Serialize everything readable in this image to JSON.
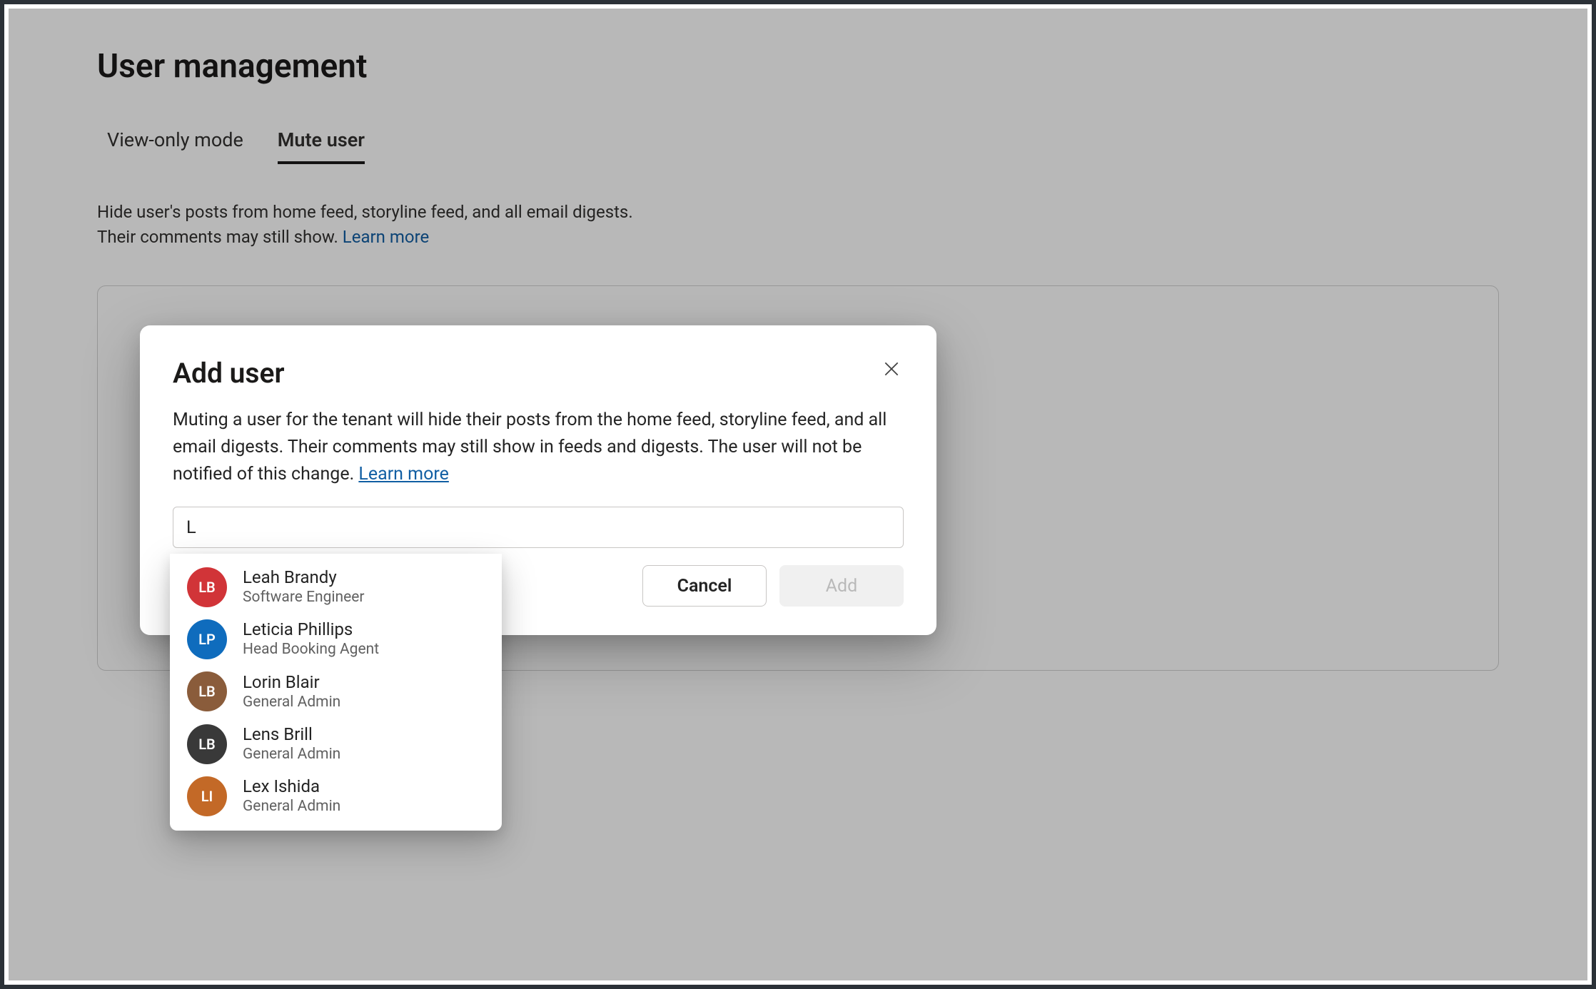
{
  "page": {
    "title": "User management",
    "tabs": [
      {
        "label": "View-only mode",
        "active": false
      },
      {
        "label": "Mute user",
        "active": true
      }
    ],
    "description_line1": "Hide user's posts from home feed, storyline feed, and all email digests.",
    "description_line2": "Their comments may still show. ",
    "learn_more": "Learn more"
  },
  "dialog": {
    "title": "Add user",
    "body": "Muting a user for the tenant will hide their posts from the home feed, storyline feed, and all email digests. Their comments may still show in feeds and digests. The user will not be notified of this change. ",
    "learn_more": "Learn more",
    "search_value": "L",
    "cancel_label": "Cancel",
    "add_label": "Add"
  },
  "suggestions": [
    {
      "name": "Leah Brandy",
      "role": "Software Engineer",
      "avatar_bg": "#d13438",
      "initials": "LB"
    },
    {
      "name": "Leticia Phillips",
      "role": "Head Booking Agent",
      "avatar_bg": "#0f6cbd",
      "initials": "LP"
    },
    {
      "name": "Lorin Blair",
      "role": "General Admin",
      "avatar_bg": "#8a5c3b",
      "initials": "LB"
    },
    {
      "name": "Lens Brill",
      "role": "General Admin",
      "avatar_bg": "#393939",
      "initials": "LB"
    },
    {
      "name": "Lex Ishida",
      "role": "General Admin",
      "avatar_bg": "#c36927",
      "initials": "LI"
    }
  ]
}
